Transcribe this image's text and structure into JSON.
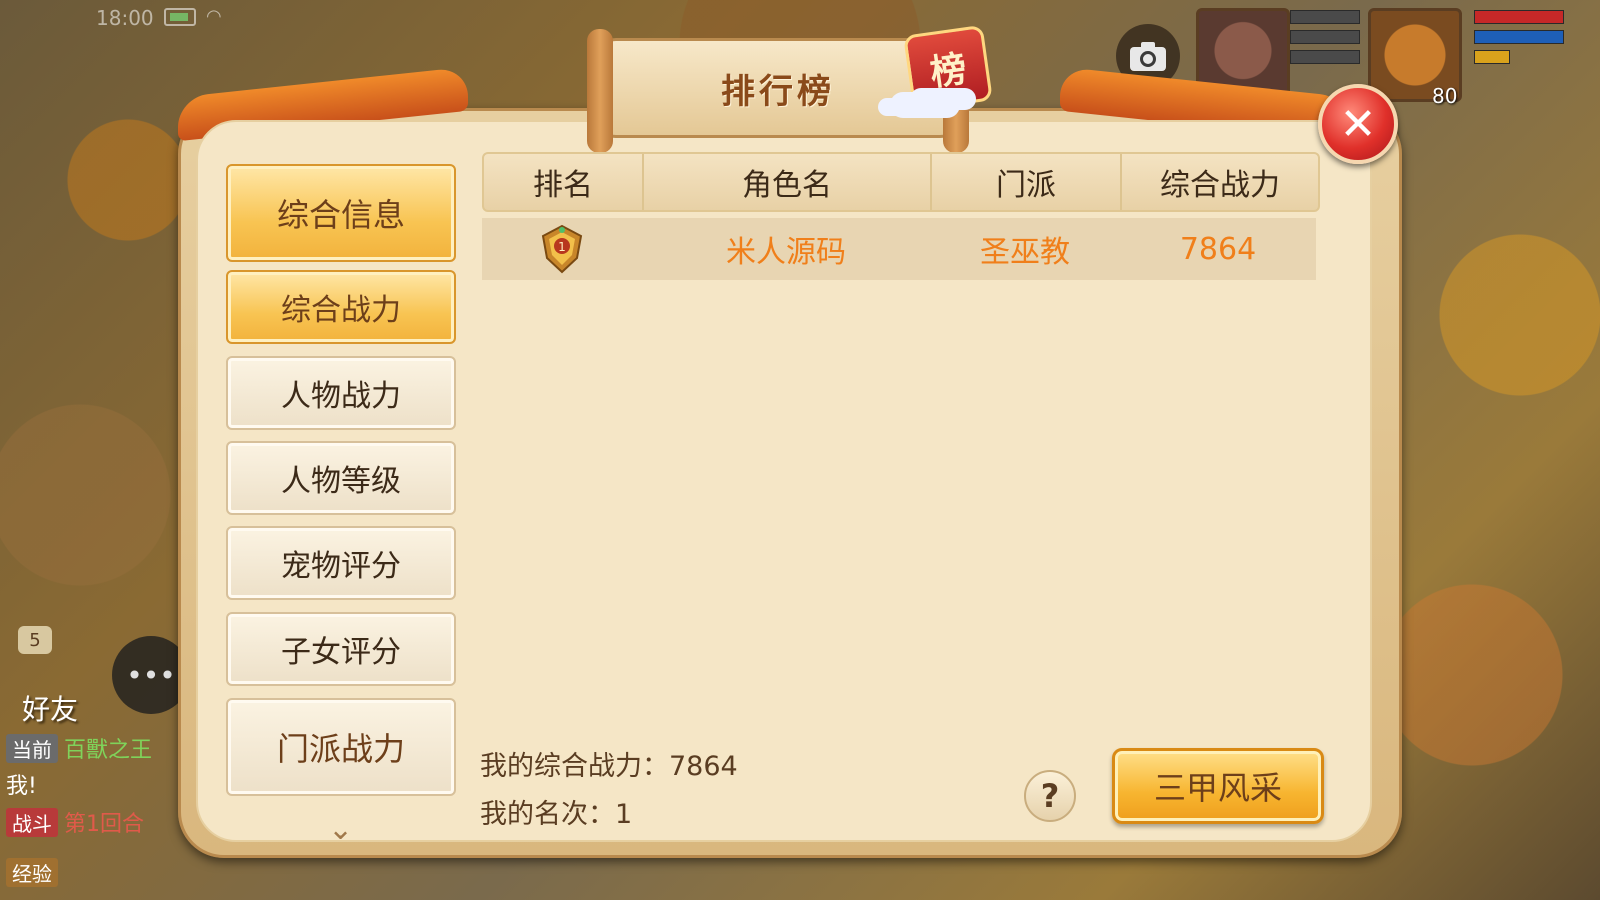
{
  "status_bar": {
    "time": "18:00"
  },
  "hud": {
    "pet_level": "80"
  },
  "chat": {
    "friend_badge_count": "5",
    "friend_label": "好友",
    "lines": [
      {
        "tag": "当前",
        "text": "百獸之王"
      },
      {
        "tag": "",
        "text": "我!"
      },
      {
        "tag": "战斗",
        "text": "第1回合"
      },
      {
        "tag": "经验",
        "text": ""
      }
    ]
  },
  "panel": {
    "title": "排行榜",
    "seal": "榜",
    "close_symbol": "✕"
  },
  "sidebar": {
    "items": [
      {
        "label": "综合信息"
      },
      {
        "label": "综合战力"
      },
      {
        "label": "人物战力"
      },
      {
        "label": "人物等级"
      },
      {
        "label": "宠物评分"
      },
      {
        "label": "子女评分"
      },
      {
        "label": "门派战力"
      }
    ],
    "active_index": 1
  },
  "table": {
    "headers": [
      "排名",
      "角色名",
      "门派",
      "综合战力"
    ],
    "rows": [
      {
        "rank": 1,
        "rank_icon": "rank-1-medal-icon",
        "name": "米人源码",
        "school": "圣巫教",
        "power": "7864"
      }
    ]
  },
  "footer": {
    "my_power_label": "我的综合战力：",
    "my_power_value": "7864",
    "my_rank_label": "我的名次：",
    "my_rank_value": "1",
    "help_symbol": "?",
    "sanjia_button": "三甲风采"
  },
  "colors": {
    "highlight_text": "#f07f1a",
    "active_tab": "#f8c452",
    "close_button": "#e0302a"
  }
}
